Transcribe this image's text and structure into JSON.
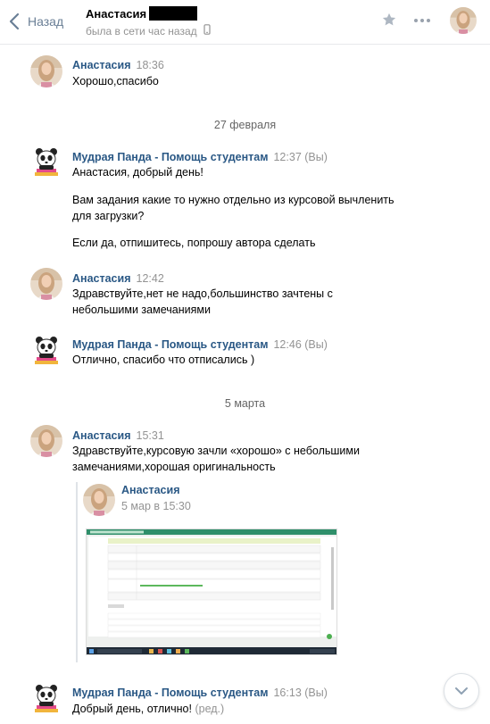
{
  "header": {
    "back_label": "Назад",
    "chat_name": "Анастасия",
    "status": "была в сети час назад"
  },
  "messages": [
    {
      "author": "Анастасия",
      "time": "18:36",
      "lines": [
        "Хорошо,спасибо"
      ]
    },
    {
      "author": "Мудрая Панда - Помощь студентам",
      "time": "12:37 (Вы)",
      "lines": [
        "Анастасия, добрый день!",
        "Вам задания какие то нужно отдельно из курсовой вычленить",
        "для загрузки?",
        "Если да, отпишитесь, попрошу автора сделать"
      ]
    },
    {
      "author": "Анастасия",
      "time": "12:42",
      "lines": [
        "Здравствуйте,нет не надо,большинство зачтены с",
        "небольшими замечаниями"
      ]
    },
    {
      "author": "Мудрая Панда - Помощь студентам",
      "time": "12:46 (Вы)",
      "lines": [
        "Отлично, спасибо что отписались )"
      ]
    },
    {
      "author": "Анастасия",
      "time": "15:31",
      "lines": [
        "Здравствуйте,курсовую зачли «хорошо» с небольшими",
        "замечаниями,хорошая оригинальность"
      ]
    },
    {
      "author": "Мудрая Панда - Помощь студентам",
      "time": "16:13 (Вы)",
      "lines": [
        "Добрый день, отлично!"
      ],
      "edited": "(ред.)"
    }
  ],
  "dates": [
    "27 февраля",
    "5 марта"
  ],
  "forwarded": {
    "author": "Анастасия",
    "date": "5 мар в 15:30"
  },
  "colors": {
    "link": "#2a5885",
    "muted": "#939393",
    "accent": "#5181b8"
  }
}
